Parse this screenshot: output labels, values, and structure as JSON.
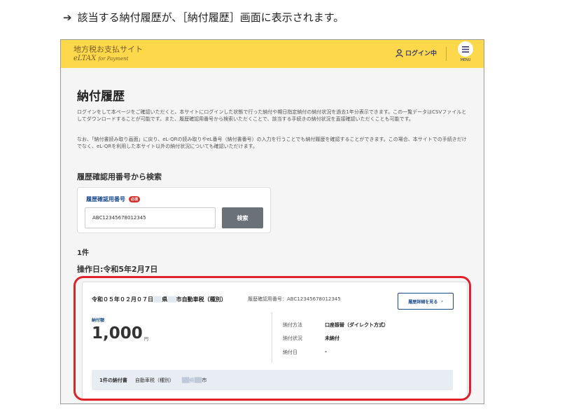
{
  "caption": "該当する納付履歴が、［納付履歴］画面に表示されます。",
  "header": {
    "site_title": "地方税お支払サイト",
    "logo_text": "eLTAX",
    "logo_sub": "for Payment",
    "login_label": "ログイン中",
    "menu_label": "MENU"
  },
  "page": {
    "title": "納付履歴",
    "description1": "ログインをして本ページをご確認いただくと、本サイトにログインした状態で行った納付や期日指定納付の納付状況を過去1年分表示できます。この一覧データはCSVファイルとしてダウンロードすることが可能です。また、履歴確認用番号から検索いただくことで、該当する手続きの納付状況を直接確認いただくことも可能です。",
    "description2": "なお、「納付書読み取り画面」に戻り、eL-QRの読み取りやeL番号（納付書番号）の入力を行うことでも納付履歴を確認することができます。この場合、本サイトでの手続きだけでなく、eL-QRを利用した本サイト以外の納付状況についても確認いただけます。"
  },
  "search": {
    "section_title": "履歴確認用番号から検索",
    "field_label": "履歴確認用番号",
    "required_badge": "必須",
    "value": "ABC12345678012345",
    "button_label": "検索"
  },
  "results": {
    "count": "1件",
    "operation_date": "操作日:令和5年2月7日"
  },
  "card": {
    "date_text": "令和０５年０２月０７日",
    "masked1": "▒▒",
    "pref": "県",
    "masked2": "▒▒",
    "tax_name": "市自動車税（種別）",
    "ref_text": "履歴確認用番号：ABC12345678012345",
    "detail_button": "履歴詳細を見る",
    "amount_label": "納付額",
    "amount": "1,000",
    "amount_unit": "円",
    "details": [
      {
        "label": "納付方法",
        "value": "口座振替（ダイレクト方式）"
      },
      {
        "label": "納付状況",
        "value": "未納付"
      },
      {
        "label": "納付日",
        "value": "-"
      }
    ],
    "slip_count": "1件の納付書",
    "slip_tax": "自動車税（種別）",
    "slip_masked": "▒▒県▒▒",
    "slip_city": "市"
  },
  "colors": {
    "header_bg": "#fdd84a",
    "highlight": "#e0202a",
    "link": "#1a4a8a",
    "search_button": "#6b7179"
  }
}
